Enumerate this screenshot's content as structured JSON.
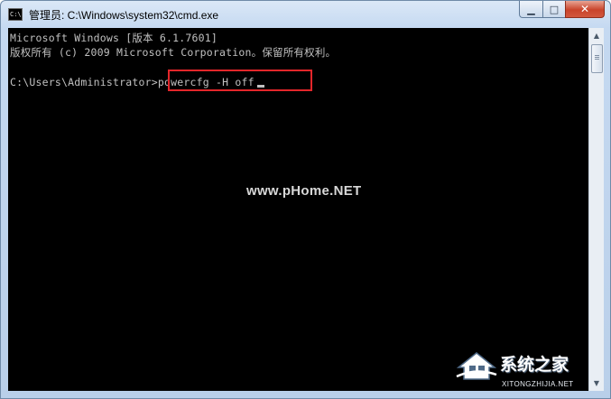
{
  "window": {
    "title": "管理员: C:\\Windows\\system32\\cmd.exe",
    "icon_label": "C:\\",
    "controls": {
      "minimize_icon": "minimize-icon",
      "maximize_icon": "maximize-icon",
      "close_icon": "close-icon",
      "minimize_glyph": "▁",
      "maximize_glyph": "□",
      "close_glyph": "✕"
    }
  },
  "console": {
    "lines": [
      "Microsoft Windows [版本 6.1.7601]",
      "版权所有 (c) 2009 Microsoft Corporation。保留所有权利。"
    ],
    "prompt": "C:\\Users\\Administrator>",
    "command": "powercfg -H off",
    "text_color": "#c0c0c0",
    "background": "#000000",
    "highlight_color": "#e3262a"
  },
  "watermark": {
    "center_text": "www.pHome.NET",
    "brand_name": "系统之家",
    "brand_sub": "XITONGZHIJIA.NET"
  },
  "scrollbar": {
    "up_glyph": "▲",
    "down_glyph": "▼"
  }
}
